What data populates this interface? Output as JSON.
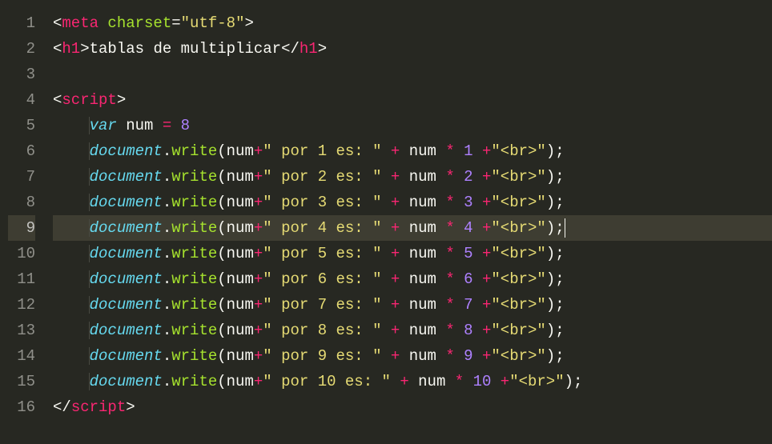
{
  "editor": {
    "active_line": 9,
    "lines": [
      {
        "n": 1,
        "tokens": [
          {
            "c": "tok-angle",
            "t": "<"
          },
          {
            "c": "tok-tag",
            "t": "meta"
          },
          {
            "c": "tok-text",
            "t": " "
          },
          {
            "c": "tok-attr",
            "t": "charset"
          },
          {
            "c": "tok-eq",
            "t": "="
          },
          {
            "c": "tok-str",
            "t": "\"utf-8\""
          },
          {
            "c": "tok-angle",
            "t": ">"
          }
        ]
      },
      {
        "n": 2,
        "tokens": [
          {
            "c": "tok-angle",
            "t": "<"
          },
          {
            "c": "tok-tag",
            "t": "h1"
          },
          {
            "c": "tok-angle",
            "t": ">"
          },
          {
            "c": "tok-text",
            "t": "tablas de multiplicar"
          },
          {
            "c": "tok-angle",
            "t": "</"
          },
          {
            "c": "tok-tag",
            "t": "h1"
          },
          {
            "c": "tok-angle",
            "t": ">"
          }
        ]
      },
      {
        "n": 3,
        "tokens": []
      },
      {
        "n": 4,
        "tokens": [
          {
            "c": "tok-angle",
            "t": "<"
          },
          {
            "c": "tok-tag",
            "t": "script"
          },
          {
            "c": "tok-angle",
            "t": ">"
          }
        ]
      },
      {
        "n": 5,
        "indent": 1,
        "tokens": [
          {
            "c": "tok-kw",
            "t": "var"
          },
          {
            "c": "tok-text",
            "t": " "
          },
          {
            "c": "tok-var",
            "t": "num"
          },
          {
            "c": "tok-text",
            "t": " "
          },
          {
            "c": "tok-op",
            "t": "="
          },
          {
            "c": "tok-text",
            "t": " "
          },
          {
            "c": "tok-num",
            "t": "8"
          }
        ]
      },
      {
        "n": 6,
        "indent": 1,
        "tokens": [
          {
            "c": "tok-obj",
            "t": "document"
          },
          {
            "c": "tok-dot",
            "t": "."
          },
          {
            "c": "tok-fn",
            "t": "write"
          },
          {
            "c": "tok-paren",
            "t": "("
          },
          {
            "c": "tok-var",
            "t": "num"
          },
          {
            "c": "tok-op",
            "t": "+"
          },
          {
            "c": "tok-str",
            "t": "\" por 1 es: \""
          },
          {
            "c": "tok-text",
            "t": " "
          },
          {
            "c": "tok-op",
            "t": "+"
          },
          {
            "c": "tok-text",
            "t": " "
          },
          {
            "c": "tok-var",
            "t": "num"
          },
          {
            "c": "tok-text",
            "t": " "
          },
          {
            "c": "tok-op",
            "t": "*"
          },
          {
            "c": "tok-text",
            "t": " "
          },
          {
            "c": "tok-num",
            "t": "1"
          },
          {
            "c": "tok-text",
            "t": " "
          },
          {
            "c": "tok-op",
            "t": "+"
          },
          {
            "c": "tok-str",
            "t": "\"<br>\""
          },
          {
            "c": "tok-paren",
            "t": ")"
          },
          {
            "c": "tok-punct",
            "t": ";"
          }
        ]
      },
      {
        "n": 7,
        "indent": 1,
        "tokens": [
          {
            "c": "tok-obj",
            "t": "document"
          },
          {
            "c": "tok-dot",
            "t": "."
          },
          {
            "c": "tok-fn",
            "t": "write"
          },
          {
            "c": "tok-paren",
            "t": "("
          },
          {
            "c": "tok-var",
            "t": "num"
          },
          {
            "c": "tok-op",
            "t": "+"
          },
          {
            "c": "tok-str",
            "t": "\" por 2 es: \""
          },
          {
            "c": "tok-text",
            "t": " "
          },
          {
            "c": "tok-op",
            "t": "+"
          },
          {
            "c": "tok-text",
            "t": " "
          },
          {
            "c": "tok-var",
            "t": "num"
          },
          {
            "c": "tok-text",
            "t": " "
          },
          {
            "c": "tok-op",
            "t": "*"
          },
          {
            "c": "tok-text",
            "t": " "
          },
          {
            "c": "tok-num",
            "t": "2"
          },
          {
            "c": "tok-text",
            "t": " "
          },
          {
            "c": "tok-op",
            "t": "+"
          },
          {
            "c": "tok-str",
            "t": "\"<br>\""
          },
          {
            "c": "tok-paren",
            "t": ")"
          },
          {
            "c": "tok-punct",
            "t": ";"
          }
        ]
      },
      {
        "n": 8,
        "indent": 1,
        "tokens": [
          {
            "c": "tok-obj",
            "t": "document"
          },
          {
            "c": "tok-dot",
            "t": "."
          },
          {
            "c": "tok-fn",
            "t": "write"
          },
          {
            "c": "tok-paren",
            "t": "("
          },
          {
            "c": "tok-var",
            "t": "num"
          },
          {
            "c": "tok-op",
            "t": "+"
          },
          {
            "c": "tok-str",
            "t": "\" por 3 es: \""
          },
          {
            "c": "tok-text",
            "t": " "
          },
          {
            "c": "tok-op",
            "t": "+"
          },
          {
            "c": "tok-text",
            "t": " "
          },
          {
            "c": "tok-var",
            "t": "num"
          },
          {
            "c": "tok-text",
            "t": " "
          },
          {
            "c": "tok-op",
            "t": "*"
          },
          {
            "c": "tok-text",
            "t": " "
          },
          {
            "c": "tok-num",
            "t": "3"
          },
          {
            "c": "tok-text",
            "t": " "
          },
          {
            "c": "tok-op",
            "t": "+"
          },
          {
            "c": "tok-str",
            "t": "\"<br>\""
          },
          {
            "c": "tok-paren",
            "t": ")"
          },
          {
            "c": "tok-punct",
            "t": ";"
          }
        ]
      },
      {
        "n": 9,
        "indent": 1,
        "tokens": [
          {
            "c": "tok-obj",
            "t": "document"
          },
          {
            "c": "tok-dot",
            "t": "."
          },
          {
            "c": "tok-fn",
            "t": "write"
          },
          {
            "c": "tok-paren",
            "t": "("
          },
          {
            "c": "tok-var",
            "t": "num"
          },
          {
            "c": "tok-op",
            "t": "+"
          },
          {
            "c": "tok-str",
            "t": "\" por 4 es: \""
          },
          {
            "c": "tok-text",
            "t": " "
          },
          {
            "c": "tok-op",
            "t": "+"
          },
          {
            "c": "tok-text",
            "t": " "
          },
          {
            "c": "tok-var",
            "t": "num"
          },
          {
            "c": "tok-text",
            "t": " "
          },
          {
            "c": "tok-op",
            "t": "*"
          },
          {
            "c": "tok-text",
            "t": " "
          },
          {
            "c": "tok-num",
            "t": "4"
          },
          {
            "c": "tok-text",
            "t": " "
          },
          {
            "c": "tok-op",
            "t": "+"
          },
          {
            "c": "tok-str",
            "t": "\"<br>\""
          },
          {
            "c": "tok-paren",
            "t": ")"
          },
          {
            "c": "tok-punct",
            "t": ";"
          }
        ]
      },
      {
        "n": 10,
        "indent": 1,
        "tokens": [
          {
            "c": "tok-obj",
            "t": "document"
          },
          {
            "c": "tok-dot",
            "t": "."
          },
          {
            "c": "tok-fn",
            "t": "write"
          },
          {
            "c": "tok-paren",
            "t": "("
          },
          {
            "c": "tok-var",
            "t": "num"
          },
          {
            "c": "tok-op",
            "t": "+"
          },
          {
            "c": "tok-str",
            "t": "\" por 5 es: \""
          },
          {
            "c": "tok-text",
            "t": " "
          },
          {
            "c": "tok-op",
            "t": "+"
          },
          {
            "c": "tok-text",
            "t": " "
          },
          {
            "c": "tok-var",
            "t": "num"
          },
          {
            "c": "tok-text",
            "t": " "
          },
          {
            "c": "tok-op",
            "t": "*"
          },
          {
            "c": "tok-text",
            "t": " "
          },
          {
            "c": "tok-num",
            "t": "5"
          },
          {
            "c": "tok-text",
            "t": " "
          },
          {
            "c": "tok-op",
            "t": "+"
          },
          {
            "c": "tok-str",
            "t": "\"<br>\""
          },
          {
            "c": "tok-paren",
            "t": ")"
          },
          {
            "c": "tok-punct",
            "t": ";"
          }
        ]
      },
      {
        "n": 11,
        "indent": 1,
        "tokens": [
          {
            "c": "tok-obj",
            "t": "document"
          },
          {
            "c": "tok-dot",
            "t": "."
          },
          {
            "c": "tok-fn",
            "t": "write"
          },
          {
            "c": "tok-paren",
            "t": "("
          },
          {
            "c": "tok-var",
            "t": "num"
          },
          {
            "c": "tok-op",
            "t": "+"
          },
          {
            "c": "tok-str",
            "t": "\" por 6 es: \""
          },
          {
            "c": "tok-text",
            "t": " "
          },
          {
            "c": "tok-op",
            "t": "+"
          },
          {
            "c": "tok-text",
            "t": " "
          },
          {
            "c": "tok-var",
            "t": "num"
          },
          {
            "c": "tok-text",
            "t": " "
          },
          {
            "c": "tok-op",
            "t": "*"
          },
          {
            "c": "tok-text",
            "t": " "
          },
          {
            "c": "tok-num",
            "t": "6"
          },
          {
            "c": "tok-text",
            "t": " "
          },
          {
            "c": "tok-op",
            "t": "+"
          },
          {
            "c": "tok-str",
            "t": "\"<br>\""
          },
          {
            "c": "tok-paren",
            "t": ")"
          },
          {
            "c": "tok-punct",
            "t": ";"
          }
        ]
      },
      {
        "n": 12,
        "indent": 1,
        "tokens": [
          {
            "c": "tok-obj",
            "t": "document"
          },
          {
            "c": "tok-dot",
            "t": "."
          },
          {
            "c": "tok-fn",
            "t": "write"
          },
          {
            "c": "tok-paren",
            "t": "("
          },
          {
            "c": "tok-var",
            "t": "num"
          },
          {
            "c": "tok-op",
            "t": "+"
          },
          {
            "c": "tok-str",
            "t": "\" por 7 es: \""
          },
          {
            "c": "tok-text",
            "t": " "
          },
          {
            "c": "tok-op",
            "t": "+"
          },
          {
            "c": "tok-text",
            "t": " "
          },
          {
            "c": "tok-var",
            "t": "num"
          },
          {
            "c": "tok-text",
            "t": " "
          },
          {
            "c": "tok-op",
            "t": "*"
          },
          {
            "c": "tok-text",
            "t": " "
          },
          {
            "c": "tok-num",
            "t": "7"
          },
          {
            "c": "tok-text",
            "t": " "
          },
          {
            "c": "tok-op",
            "t": "+"
          },
          {
            "c": "tok-str",
            "t": "\"<br>\""
          },
          {
            "c": "tok-paren",
            "t": ")"
          },
          {
            "c": "tok-punct",
            "t": ";"
          }
        ]
      },
      {
        "n": 13,
        "indent": 1,
        "tokens": [
          {
            "c": "tok-obj",
            "t": "document"
          },
          {
            "c": "tok-dot",
            "t": "."
          },
          {
            "c": "tok-fn",
            "t": "write"
          },
          {
            "c": "tok-paren",
            "t": "("
          },
          {
            "c": "tok-var",
            "t": "num"
          },
          {
            "c": "tok-op",
            "t": "+"
          },
          {
            "c": "tok-str",
            "t": "\" por 8 es: \""
          },
          {
            "c": "tok-text",
            "t": " "
          },
          {
            "c": "tok-op",
            "t": "+"
          },
          {
            "c": "tok-text",
            "t": " "
          },
          {
            "c": "tok-var",
            "t": "num"
          },
          {
            "c": "tok-text",
            "t": " "
          },
          {
            "c": "tok-op",
            "t": "*"
          },
          {
            "c": "tok-text",
            "t": " "
          },
          {
            "c": "tok-num",
            "t": "8"
          },
          {
            "c": "tok-text",
            "t": " "
          },
          {
            "c": "tok-op",
            "t": "+"
          },
          {
            "c": "tok-str",
            "t": "\"<br>\""
          },
          {
            "c": "tok-paren",
            "t": ")"
          },
          {
            "c": "tok-punct",
            "t": ";"
          }
        ]
      },
      {
        "n": 14,
        "indent": 1,
        "tokens": [
          {
            "c": "tok-obj",
            "t": "document"
          },
          {
            "c": "tok-dot",
            "t": "."
          },
          {
            "c": "tok-fn",
            "t": "write"
          },
          {
            "c": "tok-paren",
            "t": "("
          },
          {
            "c": "tok-var",
            "t": "num"
          },
          {
            "c": "tok-op",
            "t": "+"
          },
          {
            "c": "tok-str",
            "t": "\" por 9 es: \""
          },
          {
            "c": "tok-text",
            "t": " "
          },
          {
            "c": "tok-op",
            "t": "+"
          },
          {
            "c": "tok-text",
            "t": " "
          },
          {
            "c": "tok-var",
            "t": "num"
          },
          {
            "c": "tok-text",
            "t": " "
          },
          {
            "c": "tok-op",
            "t": "*"
          },
          {
            "c": "tok-text",
            "t": " "
          },
          {
            "c": "tok-num",
            "t": "9"
          },
          {
            "c": "tok-text",
            "t": " "
          },
          {
            "c": "tok-op",
            "t": "+"
          },
          {
            "c": "tok-str",
            "t": "\"<br>\""
          },
          {
            "c": "tok-paren",
            "t": ")"
          },
          {
            "c": "tok-punct",
            "t": ";"
          }
        ]
      },
      {
        "n": 15,
        "indent": 1,
        "tokens": [
          {
            "c": "tok-obj",
            "t": "document"
          },
          {
            "c": "tok-dot",
            "t": "."
          },
          {
            "c": "tok-fn",
            "t": "write"
          },
          {
            "c": "tok-paren",
            "t": "("
          },
          {
            "c": "tok-var",
            "t": "num"
          },
          {
            "c": "tok-op",
            "t": "+"
          },
          {
            "c": "tok-str",
            "t": "\" por 10 es: \""
          },
          {
            "c": "tok-text",
            "t": " "
          },
          {
            "c": "tok-op",
            "t": "+"
          },
          {
            "c": "tok-text",
            "t": " "
          },
          {
            "c": "tok-var",
            "t": "num"
          },
          {
            "c": "tok-text",
            "t": " "
          },
          {
            "c": "tok-op",
            "t": "*"
          },
          {
            "c": "tok-text",
            "t": " "
          },
          {
            "c": "tok-num",
            "t": "10"
          },
          {
            "c": "tok-text",
            "t": " "
          },
          {
            "c": "tok-op",
            "t": "+"
          },
          {
            "c": "tok-str",
            "t": "\"<br>\""
          },
          {
            "c": "tok-paren",
            "t": ")"
          },
          {
            "c": "tok-punct",
            "t": ";"
          }
        ]
      },
      {
        "n": 16,
        "tokens": [
          {
            "c": "tok-angle",
            "t": "</"
          },
          {
            "c": "tok-tag",
            "t": "script"
          },
          {
            "c": "tok-angle",
            "t": ">"
          }
        ]
      }
    ]
  }
}
